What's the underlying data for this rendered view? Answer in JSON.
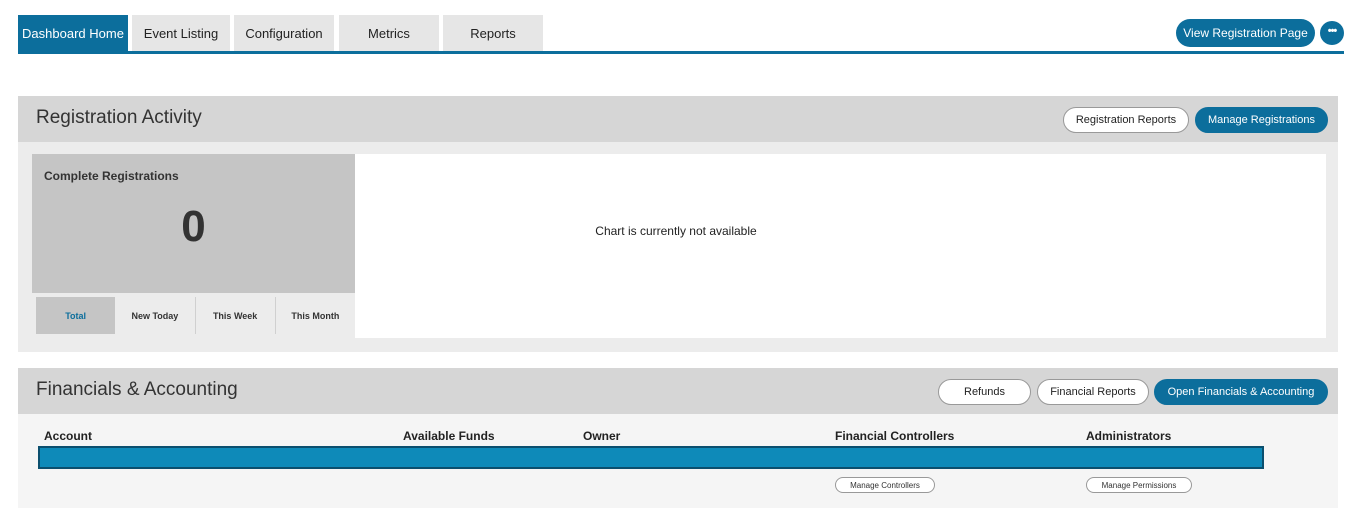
{
  "nav": {
    "tabs": [
      {
        "label": "Dashboard Home",
        "active": true
      },
      {
        "label": "Event Listing",
        "active": false
      },
      {
        "label": "Configuration",
        "active": false
      },
      {
        "label": "Metrics",
        "active": false
      },
      {
        "label": "Reports",
        "active": false
      }
    ],
    "view_registration_label": "View Registration Page",
    "more_icon": "ellipsis-icon"
  },
  "registration": {
    "title": "Registration Activity",
    "reports_button": "Registration Reports",
    "manage_button": "Manage Registrations",
    "stat": {
      "title": "Complete Registrations",
      "value": "0",
      "tabs": [
        {
          "label": "Total",
          "active": true
        },
        {
          "label": "New Today",
          "active": false
        },
        {
          "label": "This Week",
          "active": false
        },
        {
          "label": "This Month",
          "active": false
        }
      ]
    },
    "chart_message": "Chart is currently not available"
  },
  "financials": {
    "title": "Financials & Accounting",
    "refunds_button": "Refunds",
    "reports_button": "Financial Reports",
    "open_button": "Open Financials & Accounting",
    "columns": [
      "Account",
      "Available Funds",
      "Owner",
      "Financial Controllers",
      "Administrators"
    ],
    "manage_controllers_button": "Manage Controllers",
    "manage_permissions_button": "Manage Permissions"
  },
  "colors": {
    "accent": "#0c6e9c",
    "row_highlight": "#0e8ab9"
  }
}
